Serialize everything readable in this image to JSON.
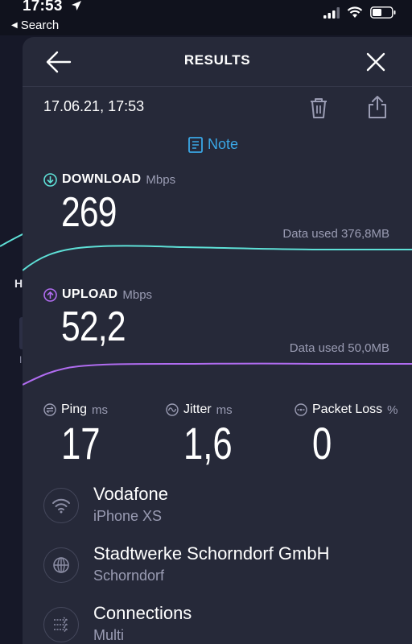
{
  "status_bar": {
    "time": "17:53",
    "back_label": "Search"
  },
  "header": {
    "title": "RESULTS"
  },
  "result": {
    "datetime": "17.06.21, 17:53",
    "note_label": "Note"
  },
  "download": {
    "label": "DOWNLOAD",
    "unit": "Mbps",
    "value": "269",
    "data_used": "Data used 376,8MB",
    "color": "#5ee0d7"
  },
  "upload": {
    "label": "UPLOAD",
    "unit": "Mbps",
    "value": "52,2",
    "data_used": "Data used 50,0MB",
    "color": "#b06cf0"
  },
  "stats": {
    "ping": {
      "label": "Ping",
      "unit": "ms",
      "value": "17"
    },
    "jitter": {
      "label": "Jitter",
      "unit": "ms",
      "value": "1,6"
    },
    "packet_loss": {
      "label": "Packet Loss",
      "unit": "%",
      "value": "0"
    }
  },
  "details": [
    {
      "title": "Vodafone",
      "subtitle": "iPhone XS",
      "icon": "wifi-icon"
    },
    {
      "title": "Stadtwerke Schorndorf GmbH",
      "subtitle": "Schorndorf",
      "icon": "globe-icon"
    },
    {
      "title": "Connections",
      "subtitle": "Multi",
      "icon": "connections-icon"
    }
  ],
  "background_page": {
    "heading_letter": "H",
    "small_letter": "I"
  },
  "colors": {
    "accent": "#3aa7e6",
    "sheet": "#262939",
    "background": "#10121d"
  }
}
